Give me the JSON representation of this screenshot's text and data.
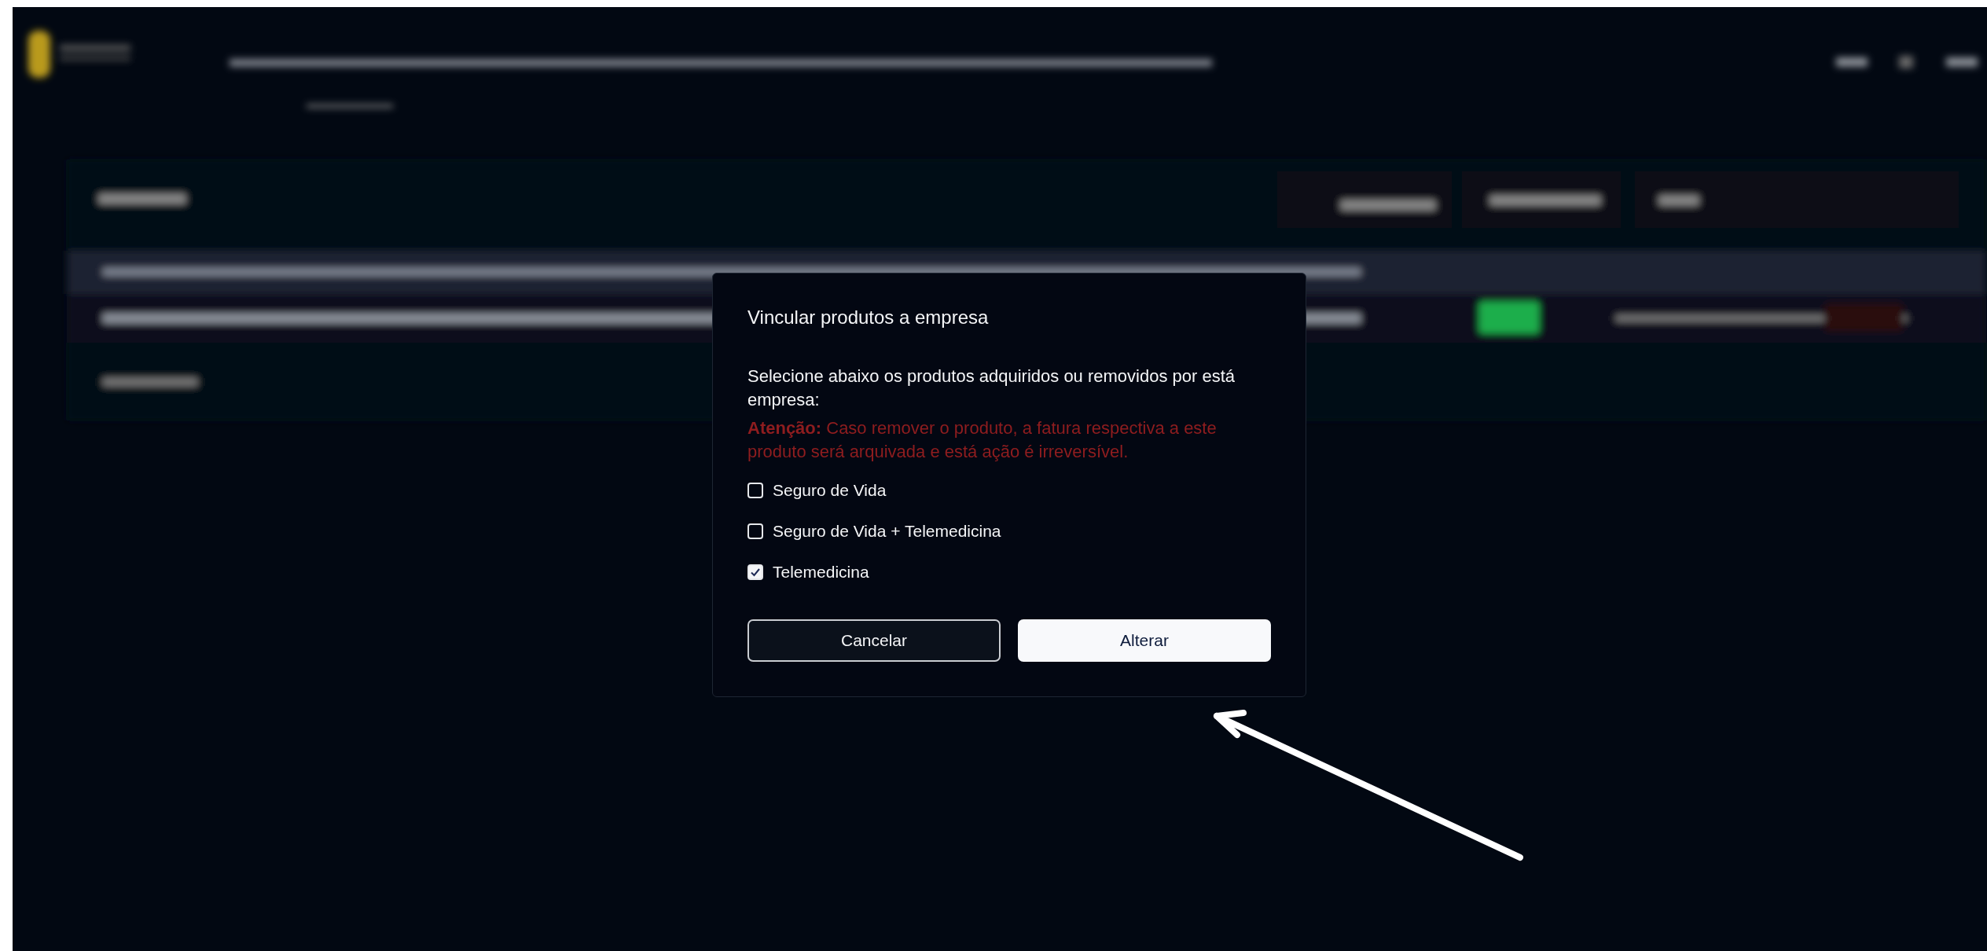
{
  "modal": {
    "title": "Vincular produtos a empresa",
    "description": "Selecione abaixo os produtos adquiridos ou removidos por está empresa:",
    "warning": "**Atenção:** Caso remover o produto, a fatura respectiva a este produto será arquivada e está ação é irreversível.",
    "products": [
      {
        "label": "Seguro de Vida",
        "checked": false
      },
      {
        "label": "Seguro de Vida + Telemedicina",
        "checked": false
      },
      {
        "label": "Telemedicina",
        "checked": true
      }
    ],
    "buttons": [
      {
        "label": "Cancelar",
        "kind": "secondary"
      },
      {
        "label": "Alterar",
        "kind": "primary"
      }
    ]
  }
}
